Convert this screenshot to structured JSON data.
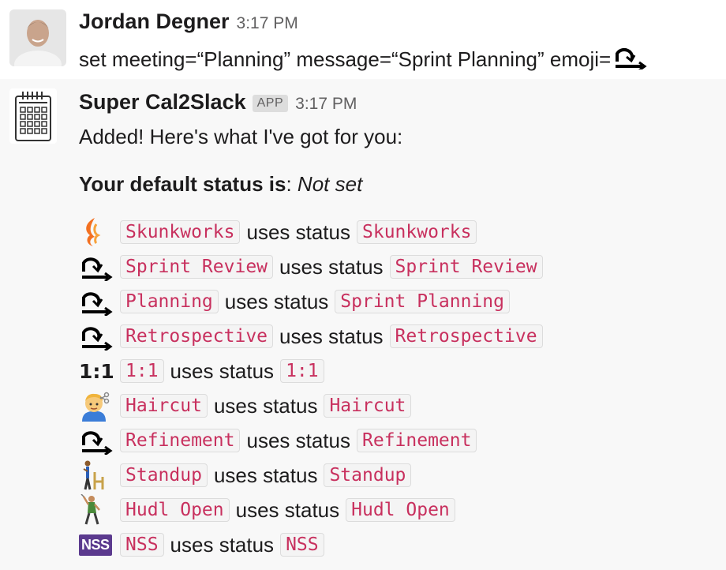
{
  "user_message": {
    "sender": "Jordan Degner",
    "time": "3:17 PM",
    "text": "set meeting=“Planning” message=“Sprint Planning” emoji="
  },
  "bot_message": {
    "sender": "Super Cal2Slack",
    "badge": "APP",
    "time": "3:17 PM",
    "intro": "Added! Here's what I've got for you:",
    "default_label": "Your default status is",
    "default_colon": ":",
    "default_value": "Not set",
    "uses_text": "uses status",
    "rows": [
      {
        "emoji": "flame-icon",
        "meeting": "Skunkworks",
        "status": "Skunkworks"
      },
      {
        "emoji": "sprint-loop-icon",
        "meeting": "Sprint Review",
        "status": "Sprint Review"
      },
      {
        "emoji": "sprint-loop-icon",
        "meeting": "Planning",
        "status": "Sprint Planning"
      },
      {
        "emoji": "sprint-loop-icon",
        "meeting": "Retrospective",
        "status": "Retrospective"
      },
      {
        "emoji": "one-to-one-icon",
        "emoji_text": "1:1",
        "meeting": "1:1",
        "status": "1:1"
      },
      {
        "emoji": "haircut-icon",
        "meeting": "Haircut",
        "status": "Haircut"
      },
      {
        "emoji": "sprint-loop-icon",
        "meeting": "Refinement",
        "status": "Refinement"
      },
      {
        "emoji": "standup-icon",
        "meeting": "Standup",
        "status": "Standup"
      },
      {
        "emoji": "golfer-icon",
        "meeting": "Hudl Open",
        "status": "Hudl Open"
      },
      {
        "emoji": "nss-icon",
        "emoji_text": "NSS",
        "meeting": "NSS",
        "status": "NSS"
      }
    ]
  },
  "colors": {
    "code_text": "#c8305e",
    "code_bg": "#f4f4f4",
    "bot_bg": "#f8f8f8",
    "nss_purple": "#5b3a8e",
    "flame_orange": "#f37021"
  }
}
